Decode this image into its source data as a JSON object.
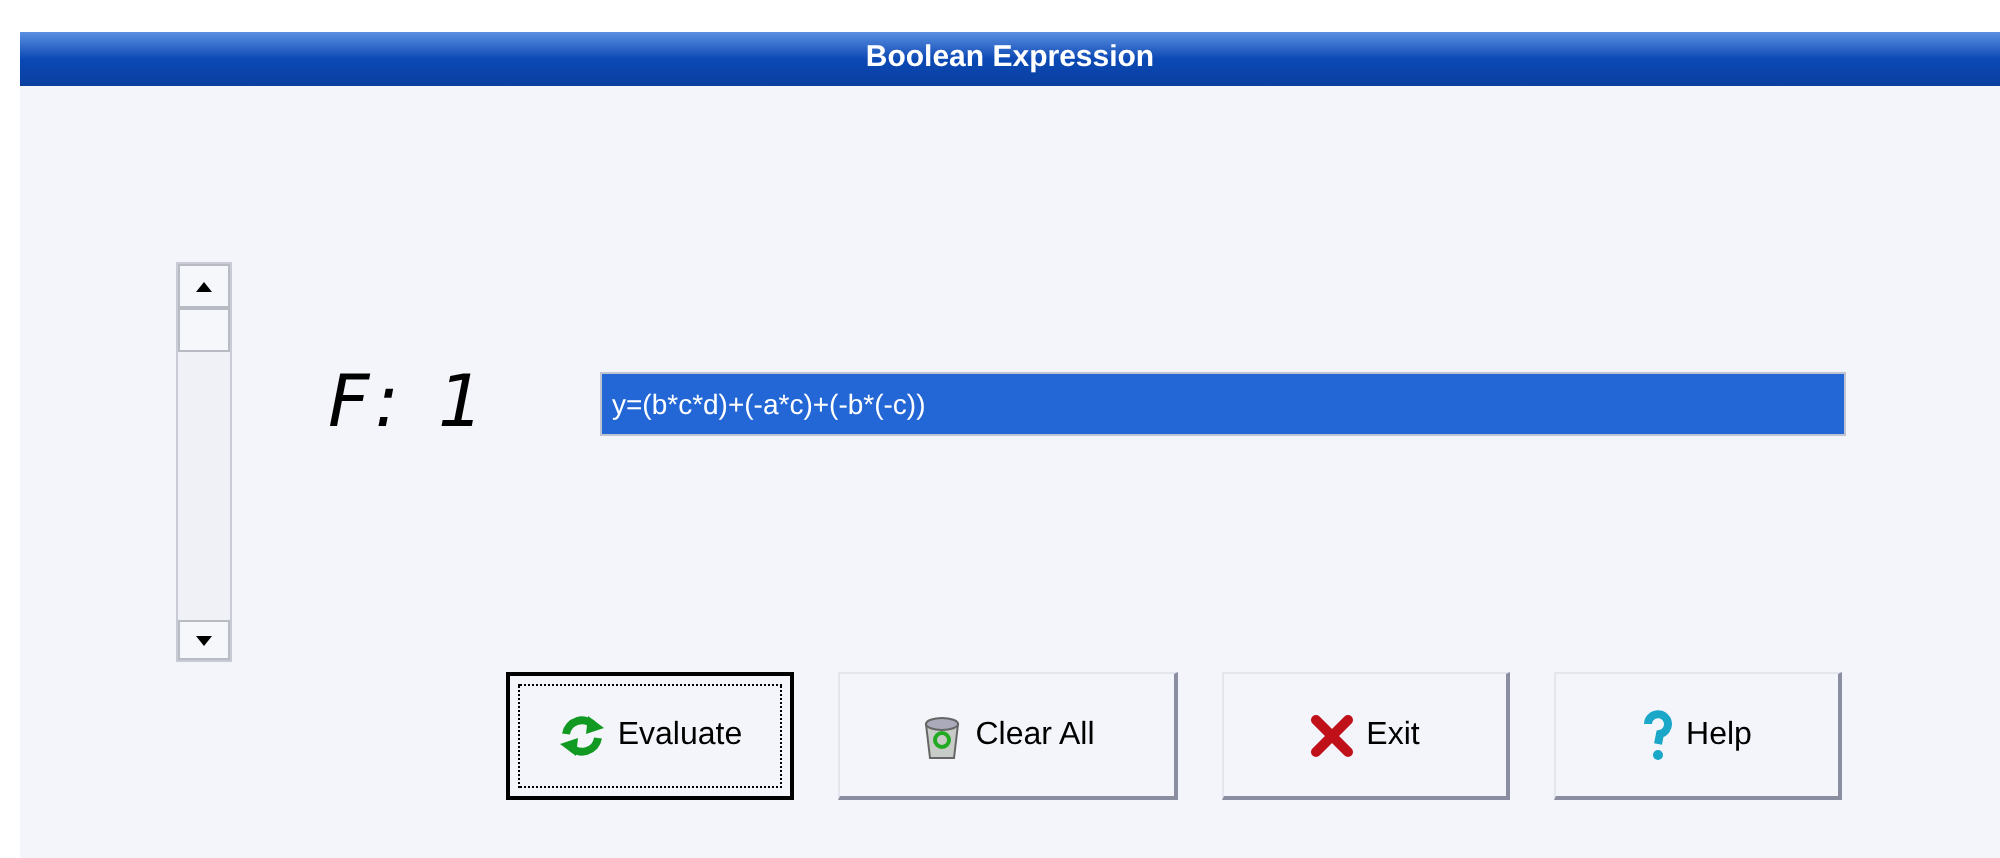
{
  "window": {
    "title": "Boolean Expression"
  },
  "function_label": "F: 1",
  "expression_field": {
    "value": "y=(b*c*d)+(-a*c)+(-b*(-c))",
    "selected": true
  },
  "buttons": [
    {
      "label": "Evaluate",
      "kind": "evaluate",
      "focused": true
    },
    {
      "label": "Clear All",
      "kind": "clear",
      "focused": false
    },
    {
      "label": "Exit",
      "kind": "exit",
      "focused": false
    },
    {
      "label": "Help",
      "kind": "help",
      "focused": false
    }
  ]
}
